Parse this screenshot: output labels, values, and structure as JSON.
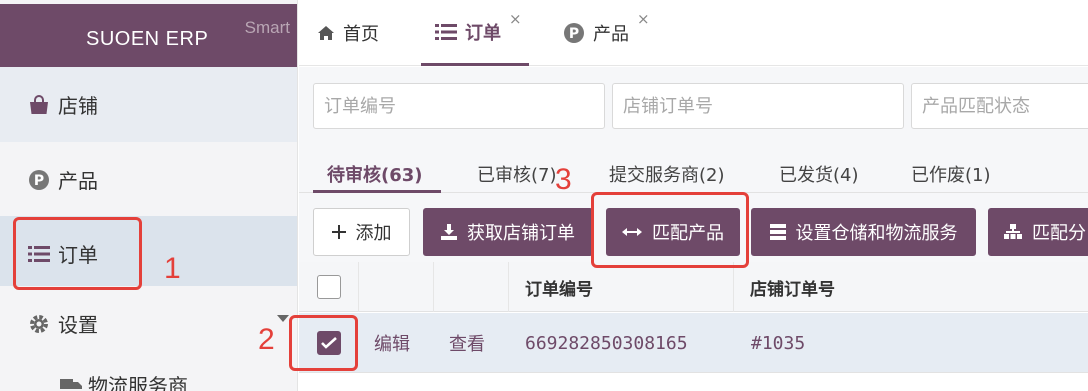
{
  "sidebar": {
    "brand": "SUOEN ERP",
    "brand_tag": "Smart",
    "items": [
      {
        "label": "店铺",
        "icon": "shopping-bag-icon"
      },
      {
        "label": "产品",
        "icon": "p-circle-icon"
      },
      {
        "label": "订单",
        "icon": "list-icon"
      },
      {
        "label": "设置",
        "icon": "gear-icon"
      }
    ],
    "sub_item": {
      "label": "物流服务商",
      "icon": "truck-icon"
    }
  },
  "top_tabs": [
    {
      "label": "首页",
      "icon": "home-icon",
      "closable": false
    },
    {
      "label": "订单",
      "icon": "list-icon",
      "closable": true,
      "active": true
    },
    {
      "label": "产品",
      "icon": "p-circle-icon",
      "closable": true
    }
  ],
  "close_glyph": "×",
  "filters": {
    "order_no_placeholder": "订单编号",
    "shop_order_no_placeholder": "店铺订单号",
    "match_status_placeholder": "产品匹配状态"
  },
  "status_tabs": [
    {
      "label": "待审核(63)",
      "active": true
    },
    {
      "label": "已审核(7)"
    },
    {
      "label": "提交服务商(2)"
    },
    {
      "label": "已发货(4)"
    },
    {
      "label": "已作废(1)"
    }
  ],
  "actions": {
    "add": "添加",
    "fetch": "获取店铺订单",
    "match": "匹配产品",
    "warehouse": "设置仓储和物流服务",
    "assign": "匹配分"
  },
  "table": {
    "columns": [
      "",
      "",
      "",
      "订单编号",
      "店铺订单号"
    ],
    "rows": [
      {
        "checked": true,
        "edit": "编辑",
        "view": "查看",
        "order_no": "669282850308165",
        "shop_order_no": "#1035"
      }
    ]
  },
  "annotations": [
    "1",
    "2",
    "3"
  ],
  "colors": {
    "accent": "#6e4a68",
    "annotation": "#e4403a",
    "row_selected": "#e6ecf3"
  }
}
